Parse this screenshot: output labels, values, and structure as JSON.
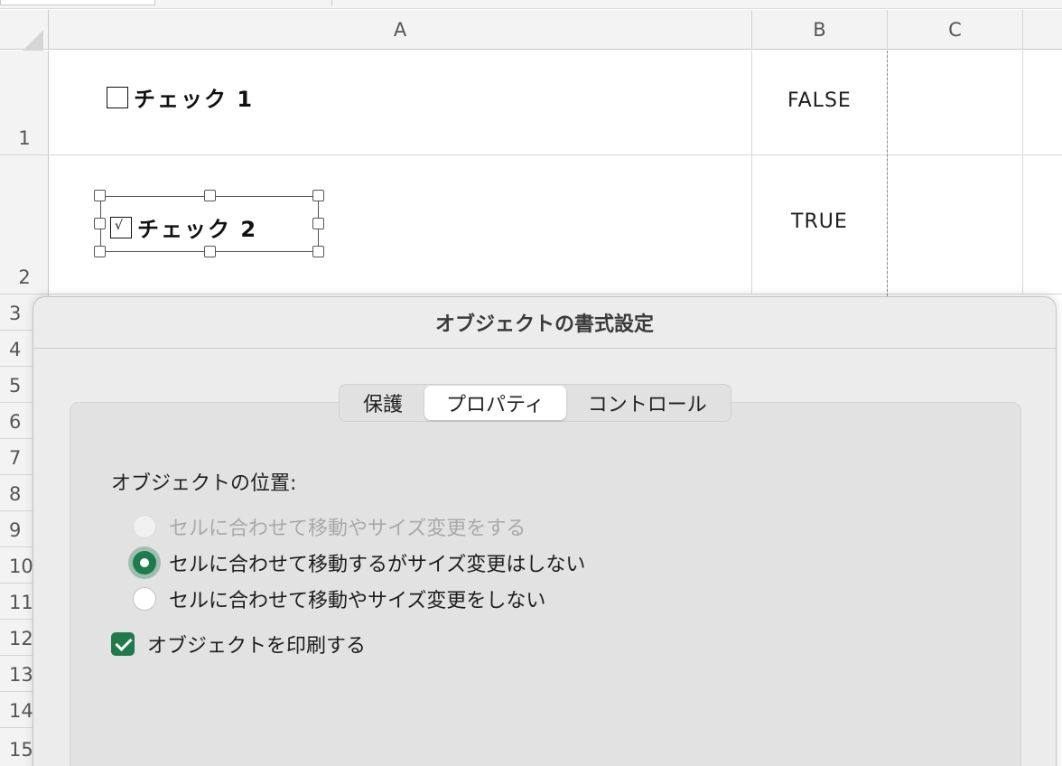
{
  "sheet": {
    "columns": [
      "A",
      "B",
      "C"
    ],
    "rows": [
      "1",
      "2",
      "3",
      "4",
      "5",
      "6",
      "7",
      "8",
      "9",
      "10",
      "11",
      "12",
      "13",
      "14",
      "15"
    ],
    "cells": {
      "A1_checkbox_label": "チェック 1",
      "A1_checkbox_checked": false,
      "B1": "FALSE",
      "A2_checkbox_label": "チェック 2",
      "A2_checkbox_checked": true,
      "B2": "TRUE"
    }
  },
  "dialog": {
    "title": "オブジェクトの書式設定",
    "tabs": [
      {
        "label": "保護",
        "active": false
      },
      {
        "label": "プロパティ",
        "active": true
      },
      {
        "label": "コントロール",
        "active": false
      }
    ],
    "section_label": "オブジェクトの位置:",
    "radio_options": [
      {
        "label": "セルに合わせて移動やサイズ変更をする",
        "state": "disabled"
      },
      {
        "label": "セルに合わせて移動するがサイズ変更はしない",
        "state": "selected"
      },
      {
        "label": "セルに合わせて移動やサイズ変更をしない",
        "state": "unselected"
      }
    ],
    "print_checkbox": {
      "label": "オブジェクトを印刷する",
      "checked": true
    }
  },
  "colors": {
    "accent_green": "#1f7a4c",
    "header_gray": "#f3f3f3",
    "dialog_bg": "#ececec"
  }
}
